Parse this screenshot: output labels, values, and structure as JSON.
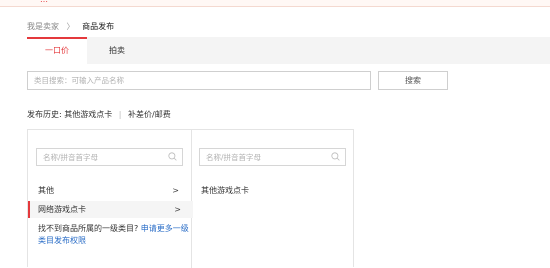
{
  "notice": {
    "text": "…",
    "link": ""
  },
  "breadcrumb": {
    "parent": "我是卖家",
    "separator": "〉",
    "current": "商品发布"
  },
  "tabs": [
    {
      "label": "一口价"
    },
    {
      "label": "拍卖"
    }
  ],
  "search": {
    "placeholder": "类目搜索：可输入产品名称",
    "button_label": "搜索"
  },
  "history": {
    "label": "发布历史:",
    "items": [
      "其他游戏点卡",
      "补差价/邮费"
    ],
    "separator": "|"
  },
  "category_panel": {
    "left": {
      "search_placeholder": "名称/拼音首字母",
      "items": [
        {
          "label": "其他",
          "chevron": ">"
        },
        {
          "label": "网络游戏点卡",
          "chevron": ">"
        }
      ],
      "missing_prefix": "找不到商品所属的一级类目?",
      "missing_link": "申请更多一级类目发布权限"
    },
    "right": {
      "search_placeholder": "名称/拼音首字母",
      "items": [
        {
          "label": "其他游戏点卡"
        }
      ]
    }
  },
  "colors": {
    "accent": "#e4393c",
    "link": "#2a6dc7",
    "border": "#e4e4e4"
  }
}
